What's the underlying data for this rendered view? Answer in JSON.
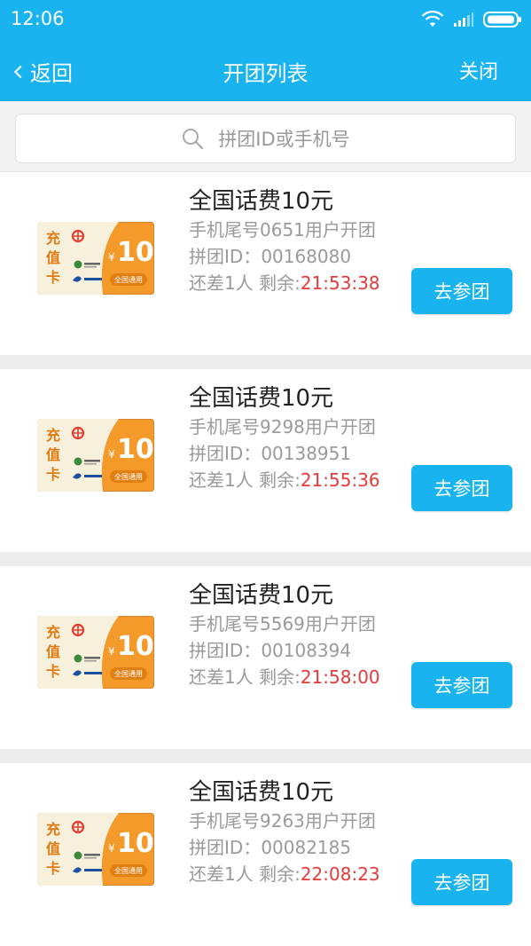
{
  "status_bar": {
    "time": "12:06"
  },
  "nav": {
    "back_label": "返回",
    "title": "开团列表",
    "close_label": "关闭"
  },
  "search": {
    "placeholder": "拼团ID或手机号"
  },
  "card_art": {
    "chars": [
      "充",
      "值",
      "卡"
    ],
    "value": "10",
    "currency": "¥",
    "badge": "全国通用",
    "colors": {
      "orange": "#f39a2b",
      "cream": "#f7f0dc",
      "red": "#e43c2f",
      "blue": "#1f4fa0"
    }
  },
  "groups": [
    {
      "title": "全国话费10元",
      "tail_text": "手机尾号0651用户开团",
      "group_id_label": "拼团ID：",
      "group_id": "00168080",
      "remain_text": "还差1人  剩余:",
      "countdown": "21:53:38",
      "button_label": "去参团"
    },
    {
      "title": "全国话费10元",
      "tail_text": "手机尾号9298用户开团",
      "group_id_label": "拼团ID：",
      "group_id": "00138951",
      "remain_text": "还差1人  剩余:",
      "countdown": "21:55:36",
      "button_label": "去参团"
    },
    {
      "title": "全国话费10元",
      "tail_text": "手机尾号5569用户开团",
      "group_id_label": "拼团ID：",
      "group_id": "00108394",
      "remain_text": "还差1人  剩余:",
      "countdown": "21:58:00",
      "button_label": "去参团"
    },
    {
      "title": "全国话费10元",
      "tail_text": "手机尾号9263用户开团",
      "group_id_label": "拼团ID：",
      "group_id": "00082185",
      "remain_text": "还差1人  剩余:",
      "countdown": "22:08:23",
      "button_label": "去参团"
    }
  ],
  "colors": {
    "header_bg": "#19b4f0",
    "countdown_red": "#e53a3a",
    "button_bg": "#19b4f0"
  }
}
